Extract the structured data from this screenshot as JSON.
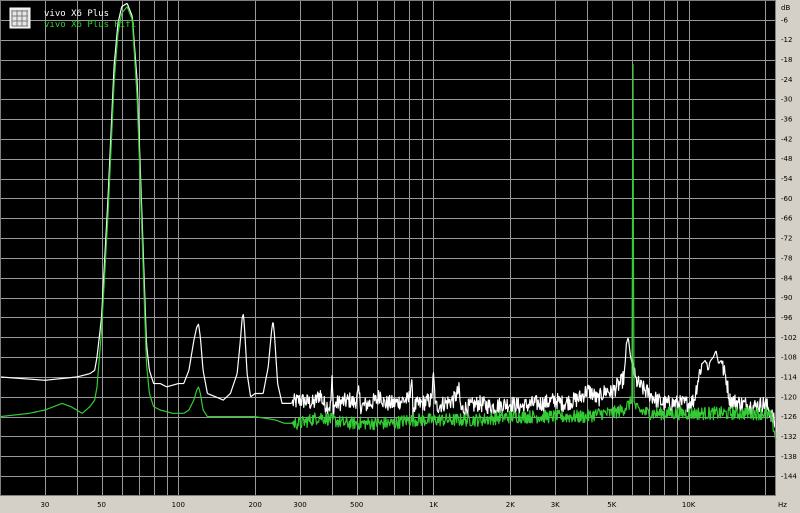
{
  "chart_data": {
    "type": "line",
    "xscale": "log",
    "xlim": [
      20,
      22000
    ],
    "ylim": [
      -150,
      0
    ],
    "grid": true,
    "legend_position": "top-left",
    "legend_icon": "grid-icon",
    "x_unit_label": "Hz",
    "x_ticks": [
      {
        "value": 30,
        "label": "30"
      },
      {
        "value": 50,
        "label": "50"
      },
      {
        "value": 100,
        "label": "100"
      },
      {
        "value": 200,
        "label": "200"
      },
      {
        "value": 300,
        "label": "300"
      },
      {
        "value": 500,
        "label": "500"
      },
      {
        "value": 1000,
        "label": "1K"
      },
      {
        "value": 2000,
        "label": "2K"
      },
      {
        "value": 3000,
        "label": "3K"
      },
      {
        "value": 5000,
        "label": "5K"
      },
      {
        "value": 10000,
        "label": "10K"
      }
    ],
    "y_ticks": [
      {
        "value": 0,
        "label": "dB"
      },
      {
        "value": -6,
        "label": "-6"
      },
      {
        "value": -12,
        "label": "-12"
      },
      {
        "value": -18,
        "label": "-18"
      },
      {
        "value": -24,
        "label": "-24"
      },
      {
        "value": -30,
        "label": "-30"
      },
      {
        "value": -36,
        "label": "-36"
      },
      {
        "value": -42,
        "label": "-42"
      },
      {
        "value": -48,
        "label": "-48"
      },
      {
        "value": -54,
        "label": "-54"
      },
      {
        "value": -60,
        "label": "-60"
      },
      {
        "value": -66,
        "label": "-66"
      },
      {
        "value": -72,
        "label": "-72"
      },
      {
        "value": -78,
        "label": "-78"
      },
      {
        "value": -84,
        "label": "-84"
      },
      {
        "value": -90,
        "label": "-90"
      },
      {
        "value": -96,
        "label": "-96"
      },
      {
        "value": -102,
        "label": "-102"
      },
      {
        "value": -108,
        "label": "-108"
      },
      {
        "value": -114,
        "label": "-114"
      },
      {
        "value": -120,
        "label": "-120"
      },
      {
        "value": -126,
        "label": "-126"
      },
      {
        "value": -132,
        "label": "-132"
      },
      {
        "value": -138,
        "label": "-138"
      },
      {
        "value": -144,
        "label": "-144"
      }
    ],
    "series": [
      {
        "name": "vivo X6 Plus",
        "color": "#ffffff",
        "points": [
          [
            20,
            -114
          ],
          [
            30,
            -115
          ],
          [
            40,
            -114
          ],
          [
            45,
            -113
          ],
          [
            47,
            -112
          ],
          [
            48,
            -108
          ],
          [
            50,
            -96
          ],
          [
            53,
            -60
          ],
          [
            56,
            -20
          ],
          [
            58,
            -7
          ],
          [
            60,
            -2
          ],
          [
            63,
            -1
          ],
          [
            66,
            -5
          ],
          [
            69,
            -25
          ],
          [
            72,
            -65
          ],
          [
            75,
            -104
          ],
          [
            77,
            -112
          ],
          [
            80,
            -116
          ],
          [
            85,
            -116
          ],
          [
            90,
            -117
          ],
          [
            100,
            -116
          ],
          [
            105,
            -116
          ],
          [
            110,
            -112
          ],
          [
            115,
            -103
          ],
          [
            118,
            -99
          ],
          [
            120,
            -98
          ],
          [
            122,
            -102
          ],
          [
            125,
            -112
          ],
          [
            130,
            -119
          ],
          [
            140,
            -120
          ],
          [
            150,
            -121
          ],
          [
            160,
            -119
          ],
          [
            170,
            -113
          ],
          [
            175,
            -103
          ],
          [
            178,
            -96
          ],
          [
            180,
            -95
          ],
          [
            182,
            -100
          ],
          [
            186,
            -113
          ],
          [
            192,
            -120
          ],
          [
            200,
            -119
          ],
          [
            215,
            -119
          ],
          [
            225,
            -111
          ],
          [
            232,
            -100
          ],
          [
            235,
            -97
          ],
          [
            238,
            -101
          ],
          [
            245,
            -116
          ],
          [
            255,
            -122
          ],
          [
            275,
            -122
          ],
          [
            300,
            -121
          ],
          [
            340,
            -122
          ],
          [
            360,
            -119
          ],
          [
            370,
            -122
          ],
          [
            395,
            -123
          ],
          [
            400,
            -115
          ],
          [
            405,
            -123
          ],
          [
            420,
            -122
          ],
          [
            470,
            -121
          ],
          [
            490,
            -122
          ],
          [
            510,
            -119
          ],
          [
            520,
            -123
          ],
          [
            560,
            -122
          ],
          [
            600,
            -121
          ],
          [
            620,
            -119
          ],
          [
            640,
            -122
          ],
          [
            700,
            -122
          ],
          [
            760,
            -121
          ],
          [
            800,
            -121
          ],
          [
            820,
            -115
          ],
          [
            830,
            -123
          ],
          [
            900,
            -122
          ],
          [
            980,
            -121
          ],
          [
            1000,
            -114
          ],
          [
            1020,
            -123
          ],
          [
            1100,
            -122
          ],
          [
            1200,
            -121
          ],
          [
            1260,
            -118
          ],
          [
            1280,
            -124
          ],
          [
            1500,
            -122
          ],
          [
            1700,
            -123
          ],
          [
            2000,
            -122
          ],
          [
            2200,
            -123
          ],
          [
            2500,
            -122
          ],
          [
            2700,
            -122
          ],
          [
            3000,
            -121
          ],
          [
            3200,
            -122
          ],
          [
            3600,
            -121
          ],
          [
            3800,
            -120
          ],
          [
            4000,
            -118
          ],
          [
            4200,
            -119
          ],
          [
            4400,
            -121
          ],
          [
            4600,
            -119
          ],
          [
            4800,
            -118
          ],
          [
            5000,
            -119
          ],
          [
            5200,
            -117
          ],
          [
            5400,
            -116
          ],
          [
            5600,
            -114
          ],
          [
            5700,
            -104
          ],
          [
            5800,
            -102
          ],
          [
            5900,
            -107
          ],
          [
            6000,
            -110
          ],
          [
            6200,
            -115
          ],
          [
            6500,
            -117
          ],
          [
            7000,
            -119
          ],
          [
            7500,
            -121
          ],
          [
            8000,
            -122
          ],
          [
            9000,
            -122
          ],
          [
            10000,
            -122
          ],
          [
            10500,
            -121
          ],
          [
            11000,
            -113
          ],
          [
            11300,
            -110
          ],
          [
            11600,
            -109
          ],
          [
            11900,
            -111
          ],
          [
            12200,
            -109
          ],
          [
            12500,
            -108
          ],
          [
            12800,
            -106
          ],
          [
            13100,
            -110
          ],
          [
            13400,
            -109
          ],
          [
            13700,
            -112
          ],
          [
            14000,
            -114
          ],
          [
            14500,
            -121
          ],
          [
            16000,
            -122
          ],
          [
            18000,
            -123
          ],
          [
            20000,
            -122
          ],
          [
            21000,
            -125
          ],
          [
            22000,
            -129
          ]
        ]
      },
      {
        "name": "vivo X6 Plus Hifi",
        "color": "#33cc33",
        "points": [
          [
            20,
            -126
          ],
          [
            26,
            -125
          ],
          [
            30,
            -124
          ],
          [
            35,
            -122
          ],
          [
            38,
            -123
          ],
          [
            42,
            -125
          ],
          [
            45,
            -123
          ],
          [
            47,
            -121
          ],
          [
            48,
            -117
          ],
          [
            50,
            -100
          ],
          [
            53,
            -65
          ],
          [
            56,
            -25
          ],
          [
            58,
            -10
          ],
          [
            60,
            -4
          ],
          [
            63,
            -2
          ],
          [
            66,
            -6
          ],
          [
            69,
            -30
          ],
          [
            72,
            -70
          ],
          [
            75,
            -110
          ],
          [
            77,
            -119
          ],
          [
            80,
            -123
          ],
          [
            85,
            -124
          ],
          [
            95,
            -125
          ],
          [
            105,
            -125
          ],
          [
            110,
            -124
          ],
          [
            115,
            -121
          ],
          [
            118,
            -118
          ],
          [
            120,
            -117
          ],
          [
            122,
            -119
          ],
          [
            125,
            -124
          ],
          [
            130,
            -126
          ],
          [
            150,
            -126
          ],
          [
            180,
            -126
          ],
          [
            200,
            -126
          ],
          [
            240,
            -127
          ],
          [
            260,
            -128
          ],
          [
            300,
            -128
          ],
          [
            330,
            -127
          ],
          [
            360,
            -126
          ],
          [
            400,
            -127
          ],
          [
            450,
            -128
          ],
          [
            500,
            -128
          ],
          [
            600,
            -128
          ],
          [
            700,
            -128
          ],
          [
            800,
            -127
          ],
          [
            900,
            -127
          ],
          [
            1000,
            -127
          ],
          [
            1200,
            -127
          ],
          [
            1500,
            -127
          ],
          [
            2000,
            -126
          ],
          [
            2500,
            -126
          ],
          [
            3000,
            -126
          ],
          [
            4000,
            -126
          ],
          [
            4500,
            -125
          ],
          [
            5000,
            -125
          ],
          [
            5500,
            -124
          ],
          [
            5900,
            -122
          ],
          [
            6000,
            -120
          ],
          [
            6050,
            -14
          ],
          [
            6100,
            -122
          ],
          [
            6300,
            -124
          ],
          [
            7000,
            -125
          ],
          [
            8000,
            -125
          ],
          [
            10000,
            -125
          ],
          [
            12000,
            -125
          ],
          [
            14000,
            -125
          ],
          [
            16000,
            -125
          ],
          [
            18000,
            -125
          ],
          [
            20000,
            -125
          ],
          [
            21000,
            -126
          ],
          [
            21500,
            -129
          ],
          [
            22000,
            -133
          ]
        ]
      }
    ]
  }
}
